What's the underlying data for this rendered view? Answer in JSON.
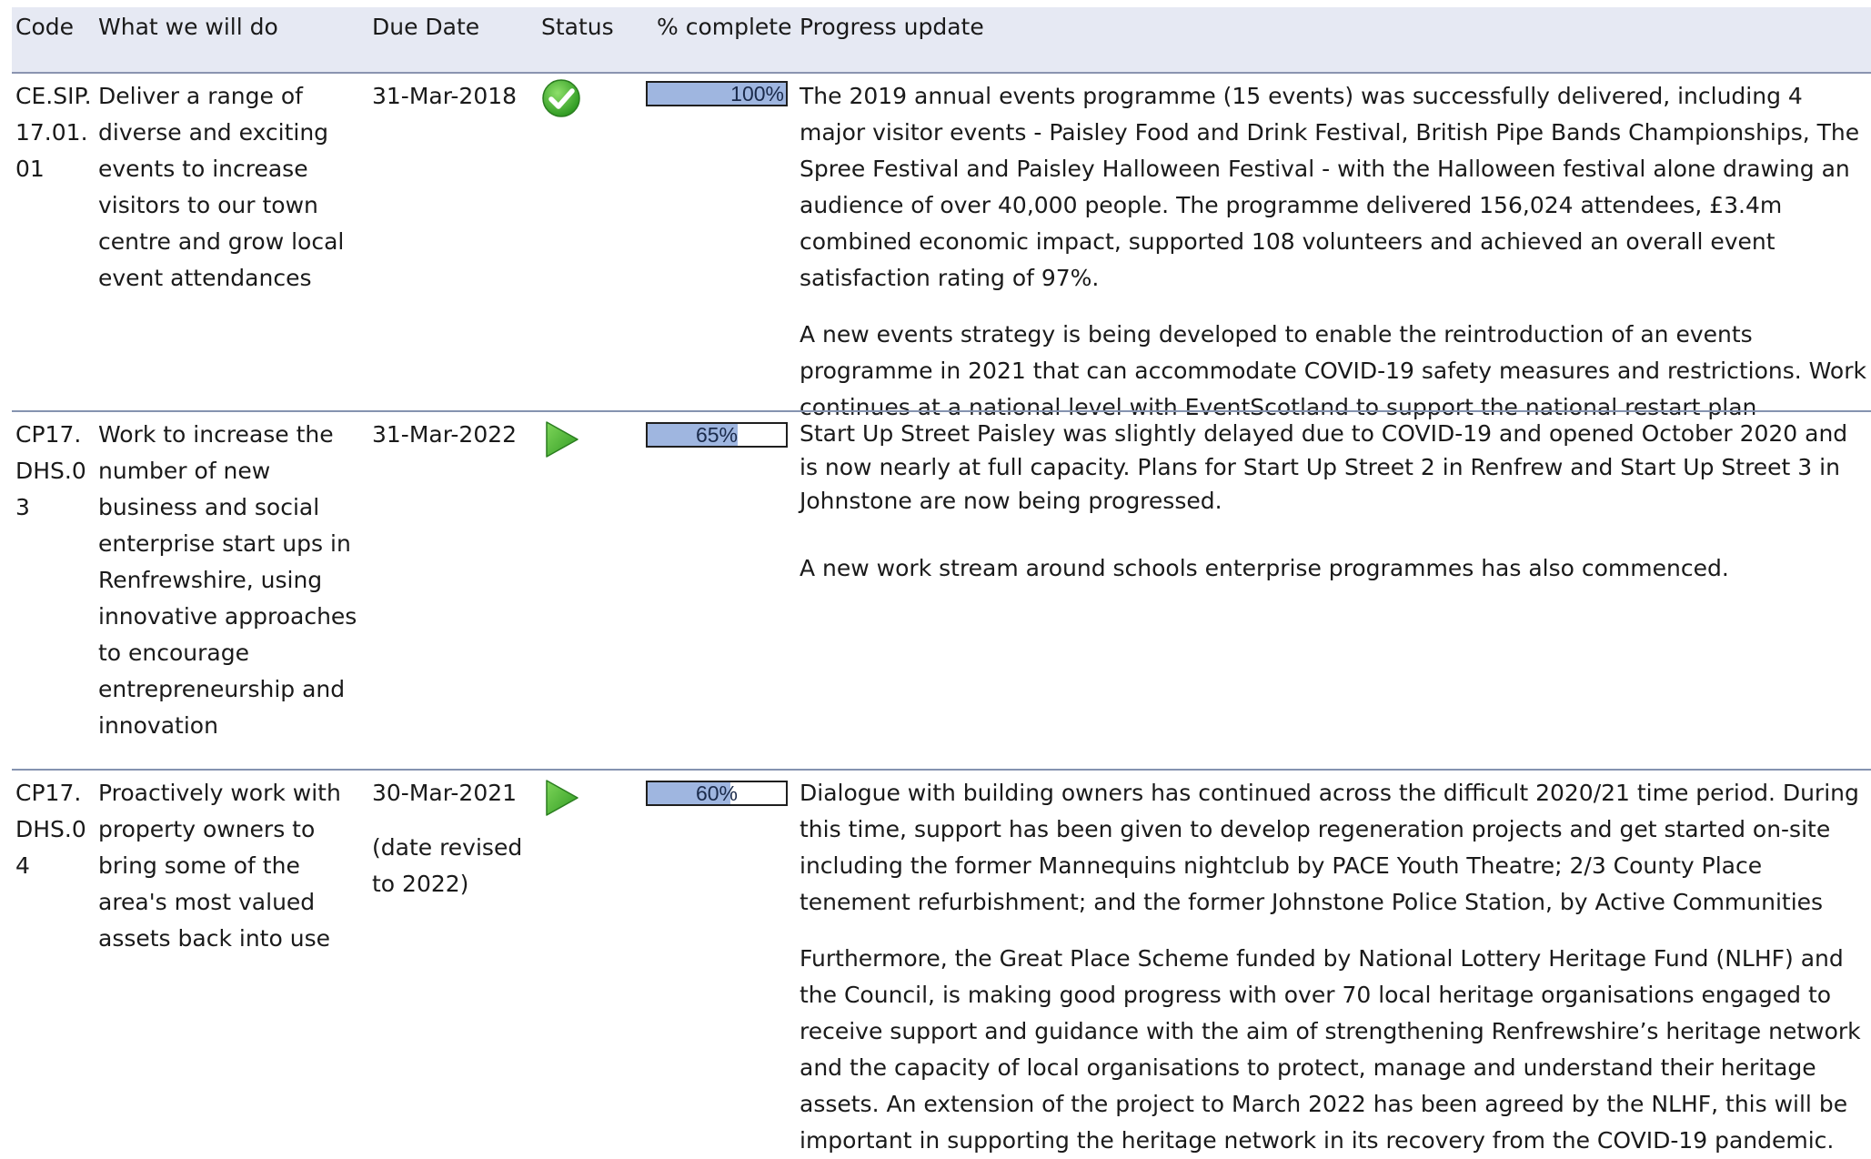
{
  "headers": {
    "code": "Code",
    "what": "What we will do",
    "due": "Due Date",
    "status": "Status",
    "complete": "% complete",
    "progress": "Progress update"
  },
  "rows": [
    {
      "code": "CE.SIP.17.01.01",
      "what": "Deliver a range of diverse and exciting events to increase visitors to our town centre and grow local event attendances",
      "due": "31-Mar-2018",
      "due_note": "",
      "status_icon": "check-complete-icon",
      "percent": 100,
      "percent_label": "100%",
      "updates": [
        "The 2019 annual events programme (15 events) was successfully delivered, including 4 major visitor events - Paisley Food and Drink Festival, British Pipe Bands Championships, The Spree Festival and Paisley Halloween Festival - with the Halloween festival alone drawing an audience of over 40,000 people. The programme delivered 156,024 attendees, £3.4m combined economic impact, supported 108 volunteers and achieved an overall event satisfaction rating of 97%.",
        "A new events strategy is being developed to enable the reintroduction of an events programme in 2021 that can accommodate COVID-19 safety measures and restrictions. Work continues at a national level with EventScotland to support the national restart plan"
      ]
    },
    {
      "code": "CP17.DHS.03",
      "what": "Work to increase the number of new business and social enterprise start ups in Renfrewshire, using innovative approaches to encourage entrepreneurship and innovation",
      "due": "31-Mar-2022",
      "due_note": "",
      "status_icon": "play-in-progress-icon",
      "percent": 65,
      "percent_label": "65%",
      "updates": [
        "Start Up Street Paisley was slightly delayed due to COVID-19 and opened October 2020 and is now nearly at full capacity. Plans for Start Up Street 2 in Renfrew and Start Up Street 3 in Johnstone are now being progressed.",
        "A new work stream around schools enterprise programmes has also commenced."
      ]
    },
    {
      "code": "CP17.DHS.04",
      "what": "Proactively work with property owners to bring some of the area's most valued assets back into use",
      "due": "30-Mar-2021",
      "due_note": "(date revised to 2022)",
      "status_icon": "play-in-progress-icon",
      "percent": 60,
      "percent_label": "60%",
      "updates": [
        "Dialogue with building owners has continued across the difficult 2020/21 time period. During this time, support has been given to develop regeneration projects and get started on-site including the former Mannequins nightclub by PACE Youth Theatre; 2/3 County Place tenement refurbishment; and the former Johnstone Police Station, by Active Communities",
        "Furthermore, the Great Place Scheme funded by National Lottery Heritage Fund (NLHF) and the Council, is making good progress with over 70 local heritage organisations engaged to receive support and guidance with the aim of strengthening Renfrewshire’s heritage network and the capacity of local organisations to protect, manage and understand their heritage assets. An extension of the project to March 2022 has been agreed by the NLHF, this will be important in supporting the heritage network in its recovery from the COVID-19 pandemic."
      ]
    }
  ],
  "colors": {
    "header_bg": "#e6e9f3",
    "row_separator": "#8593b0",
    "progress_fill": "#9fb6e0",
    "status_green": "#4cb83a"
  }
}
